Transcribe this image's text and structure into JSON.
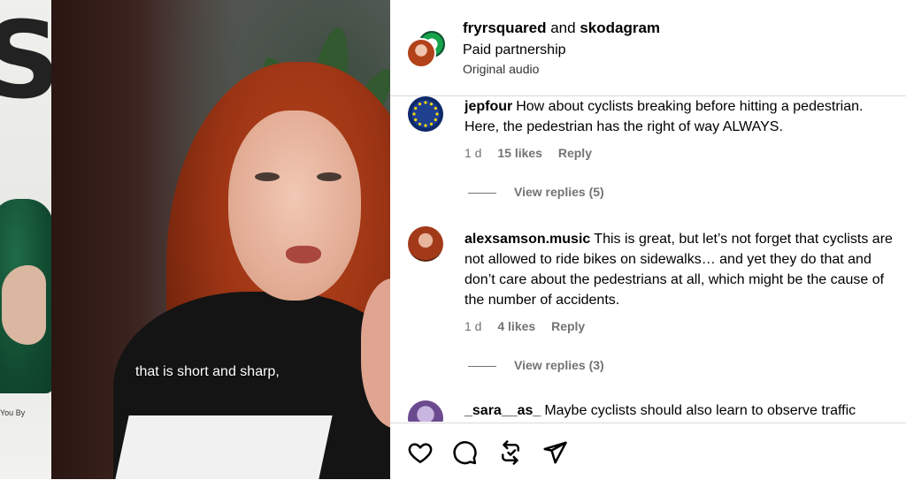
{
  "video": {
    "caption": "that is short and sharp,",
    "side_strip_text": "You By"
  },
  "header": {
    "user1": "fryrsquared",
    "joiner": "and",
    "user2": "skodagram",
    "subtitle": "Paid partnership",
    "audio": "Original audio"
  },
  "comments": [
    {
      "username": "jepfour",
      "text": "How about cyclists breaking before hitting a pedestrian. Here, the pedestrian has the right of way ALWAYS.",
      "age": "1 d",
      "likes": "15 likes",
      "reply": "Reply",
      "view_replies": "View replies (5)"
    },
    {
      "username": "alexsamson.music",
      "text": "This is great, but let’s not forget that cyclists are not allowed to ride bikes on sidewalks… and yet they do that and don’t care about the pedestrians at all, which might be the cause of the number of accidents.",
      "age": "1 d",
      "likes": "4 likes",
      "reply": "Reply",
      "view_replies": "View replies (3)"
    },
    {
      "username": "_sara__as_",
      "text": "Maybe cyclists should also learn to observe traffic"
    }
  ],
  "actions": {
    "like_icon": "heart-icon",
    "comment_icon": "comment-icon",
    "share_icon": "repost-icon",
    "send_icon": "send-icon"
  },
  "colors": {
    "meta": "#737373",
    "divider": "#dbdbdb",
    "accent_green": "#16a34a"
  }
}
